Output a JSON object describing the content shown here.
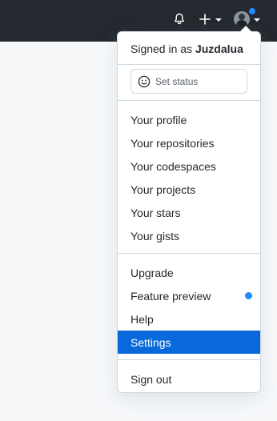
{
  "header": {
    "icons": [
      "bell-icon",
      "plus-icon",
      "avatar"
    ]
  },
  "menu": {
    "signed_in_prefix": "Signed in as",
    "username": "Juzdalua",
    "set_status": "Set status",
    "items_group1": [
      "Your profile",
      "Your repositories",
      "Your codespaces",
      "Your projects",
      "Your stars",
      "Your gists"
    ],
    "upgrade": "Upgrade",
    "feature_preview": "Feature preview",
    "help": "Help",
    "settings": "Settings",
    "sign_out": "Sign out"
  },
  "colors": {
    "header_bg": "#24292f",
    "accent": "#0969da",
    "notification_dot": "#218bff"
  }
}
